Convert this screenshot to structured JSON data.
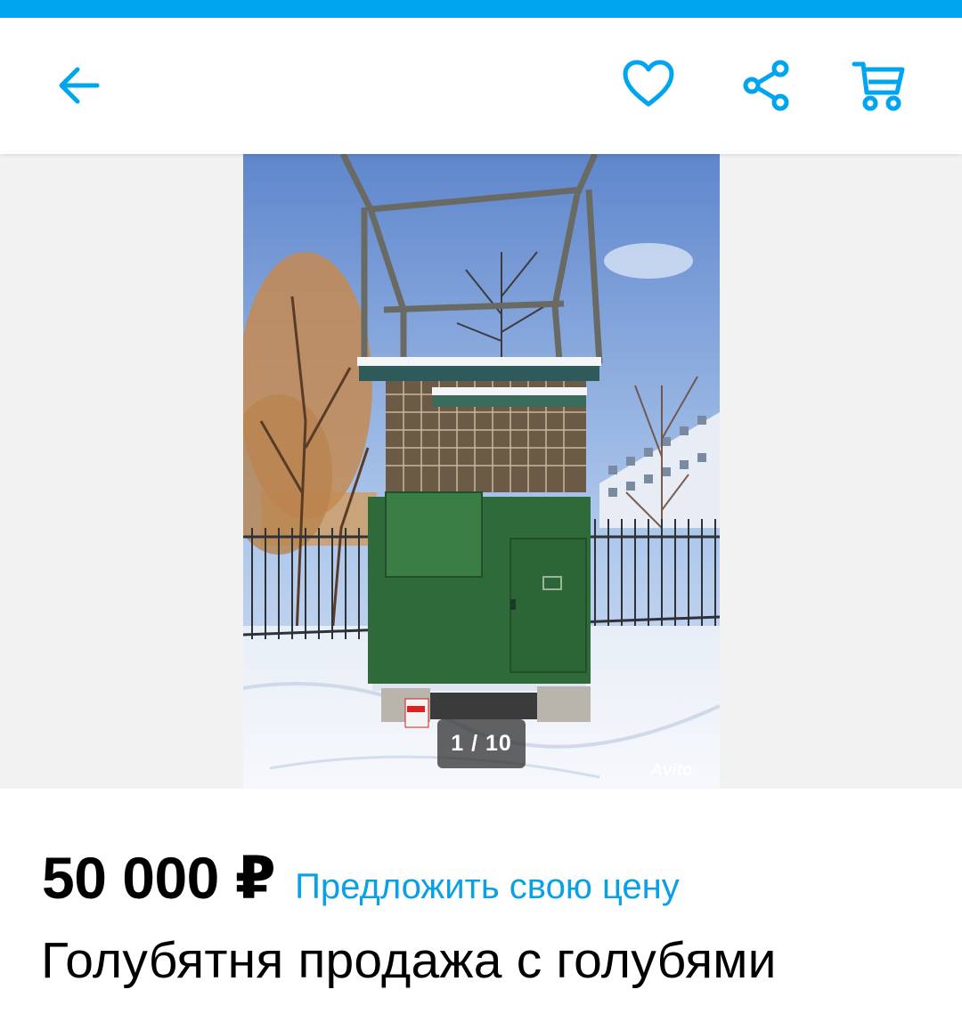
{
  "colors": {
    "accent": "#00a5f0",
    "link": "#0aa0e6",
    "price": "#000000"
  },
  "toolbar": {
    "back_icon": "arrow-left-icon",
    "favorite_icon": "heart-icon",
    "share_icon": "share-icon",
    "cart_icon": "cart-icon"
  },
  "gallery": {
    "counter": "1 / 10",
    "watermark": "Avito"
  },
  "listing": {
    "price": "50 000 ₽",
    "offer_price_link": "Предложить свою цену",
    "title": "Голубятня продажа с голубями"
  }
}
